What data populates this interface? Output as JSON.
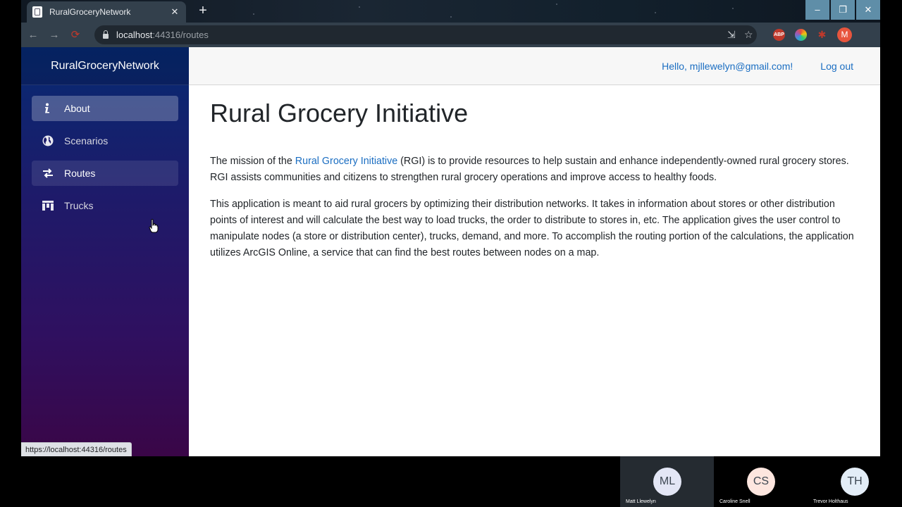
{
  "browser": {
    "tab_title": "RuralGroceryNetwork",
    "tab_close": "✕",
    "new_tab": "+",
    "window_controls": {
      "minimize": "–",
      "restore": "❐",
      "close": "✕"
    },
    "url_host": "localhost",
    "url_path": ":44316/routes",
    "profile_initial": "M",
    "ext_abp": "ABP",
    "status_url": "https://localhost:44316/routes"
  },
  "sidebar": {
    "brand": "RuralGroceryNetwork",
    "items": [
      {
        "label": "About",
        "icon": "info-icon",
        "state": "active"
      },
      {
        "label": "Scenarios",
        "icon": "globe-icon",
        "state": "normal"
      },
      {
        "label": "Routes",
        "icon": "swap-arrows-icon",
        "state": "hover"
      },
      {
        "label": "Trucks",
        "icon": "truck-icon",
        "state": "normal"
      }
    ]
  },
  "header": {
    "greeting": "Hello, mjllewelyn@gmail.com!",
    "logout": "Log out"
  },
  "content": {
    "title": "Rural Grocery Initiative",
    "p1_before": "The mission of the ",
    "p1_link": "Rural Grocery Initiative",
    "p1_after": " (RGI) is to provide resources to help sustain and enhance independently-owned rural grocery stores. RGI assists communities and citizens to strengthen rural grocery operations and improve access to healthy foods.",
    "p2": "This application is meant to aid rural grocers by optimizing their distribution networks. It takes in information about stores or other distribution points of interest and will calculate the best way to load trucks, the order to distribute to stores in, etc. The application gives the user control to manipulate nodes (a store or distribution center), trucks, demand, and more. To accomplish the routing portion of the calculations, the application utilizes ArcGIS Online, a service that can find the best routes between nodes on a map."
  },
  "participants": [
    {
      "initials": "ML",
      "name": "Matt Llewelyn",
      "color": "#e3e6f5"
    },
    {
      "initials": "CS",
      "name": "Caroline Snell",
      "color": "#fde6df"
    },
    {
      "initials": "TH",
      "name": "Trevor Holthaus",
      "color": "#e3edf7"
    }
  ],
  "colors": {
    "link": "#1b6ec2",
    "accent_red": "#c0392b"
  }
}
